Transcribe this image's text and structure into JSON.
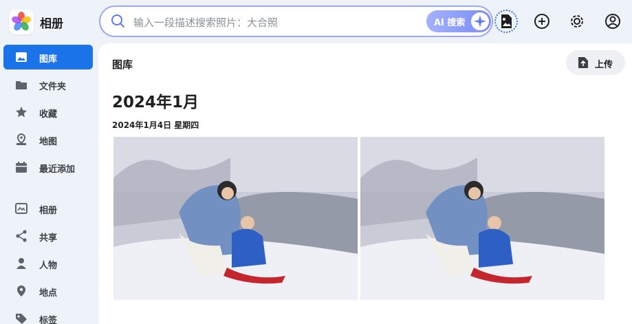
{
  "app": {
    "title": "相册"
  },
  "search": {
    "placeholder": "输入一段描述搜索照片：大合照",
    "ai_label": "AI 搜索"
  },
  "sidebar": {
    "items": [
      {
        "label": "图库",
        "icon": "photo-icon",
        "active": true
      },
      {
        "label": "文件夹",
        "icon": "folder-icon"
      },
      {
        "label": "收藏",
        "icon": "star-icon"
      },
      {
        "label": "地图",
        "icon": "map-pin-icon"
      },
      {
        "label": "最近添加",
        "icon": "calendar-icon"
      },
      {
        "label": "相册",
        "icon": "album-icon"
      },
      {
        "label": "共享",
        "icon": "share-icon"
      },
      {
        "label": "人物",
        "icon": "person-icon"
      },
      {
        "label": "地点",
        "icon": "location-icon"
      },
      {
        "label": "标签",
        "icon": "tag-icon"
      }
    ]
  },
  "main": {
    "title": "图库",
    "upload_label": "上传",
    "month": "2024年1月",
    "date": "2024年1月4日 星期四"
  },
  "colors": {
    "accent": "#1a73e8",
    "search_border": "#9aa9f2",
    "ai_gradient_start": "#a3b1ff",
    "ai_gradient_end": "#7b8cf6"
  }
}
